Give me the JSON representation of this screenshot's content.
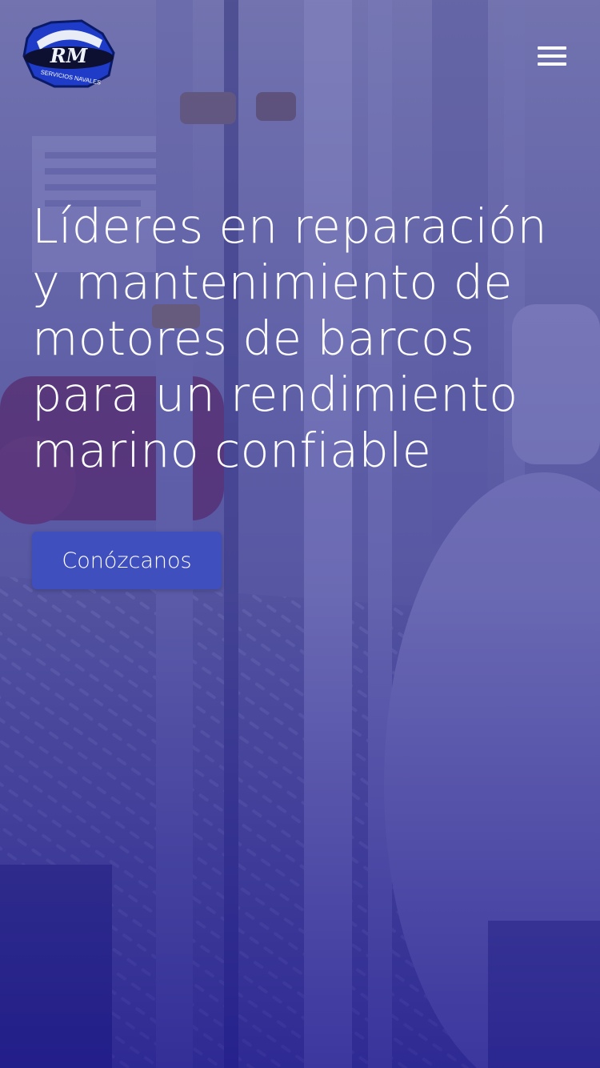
{
  "header": {
    "logo_text": "RM",
    "logo_subtext": "SERVICIOS NAVALES",
    "menu_icon": "hamburger-menu-icon"
  },
  "hero": {
    "headline": "Líderes en reparación y mantenimiento de motores de barcos para un rendimiento marino confiable",
    "cta_label": "Conózcanos",
    "background_image": "ship engine room with pipes and metal grating",
    "overlay_color": "#2e2c96",
    "button_color": "#3f4fbd"
  }
}
